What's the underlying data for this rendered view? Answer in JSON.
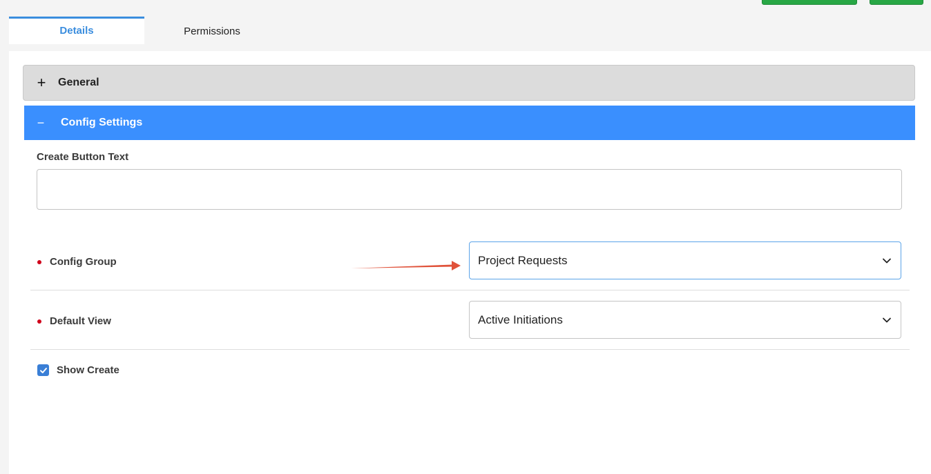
{
  "tabs": [
    {
      "label": "Details",
      "active": true
    },
    {
      "label": "Permissions",
      "active": false
    }
  ],
  "accordion": {
    "general": {
      "icon": "plus-icon",
      "title": "General",
      "expanded": false
    },
    "config": {
      "icon": "minus-icon",
      "title": "Config Settings",
      "expanded": true
    }
  },
  "form": {
    "create_button_text": {
      "label": "Create Button Text",
      "value": ""
    },
    "config_group": {
      "label": "Config Group",
      "value": "Project Requests",
      "required": true
    },
    "default_view": {
      "label": "Default View",
      "value": "Active Initiations",
      "required": true
    },
    "show_create": {
      "label": "Show Create",
      "checked": true
    }
  },
  "colors": {
    "accent": "#3a8ffe",
    "required": "#d0021b",
    "annotation_arrow": "#e0523a",
    "top_buttons": "#28a745"
  }
}
